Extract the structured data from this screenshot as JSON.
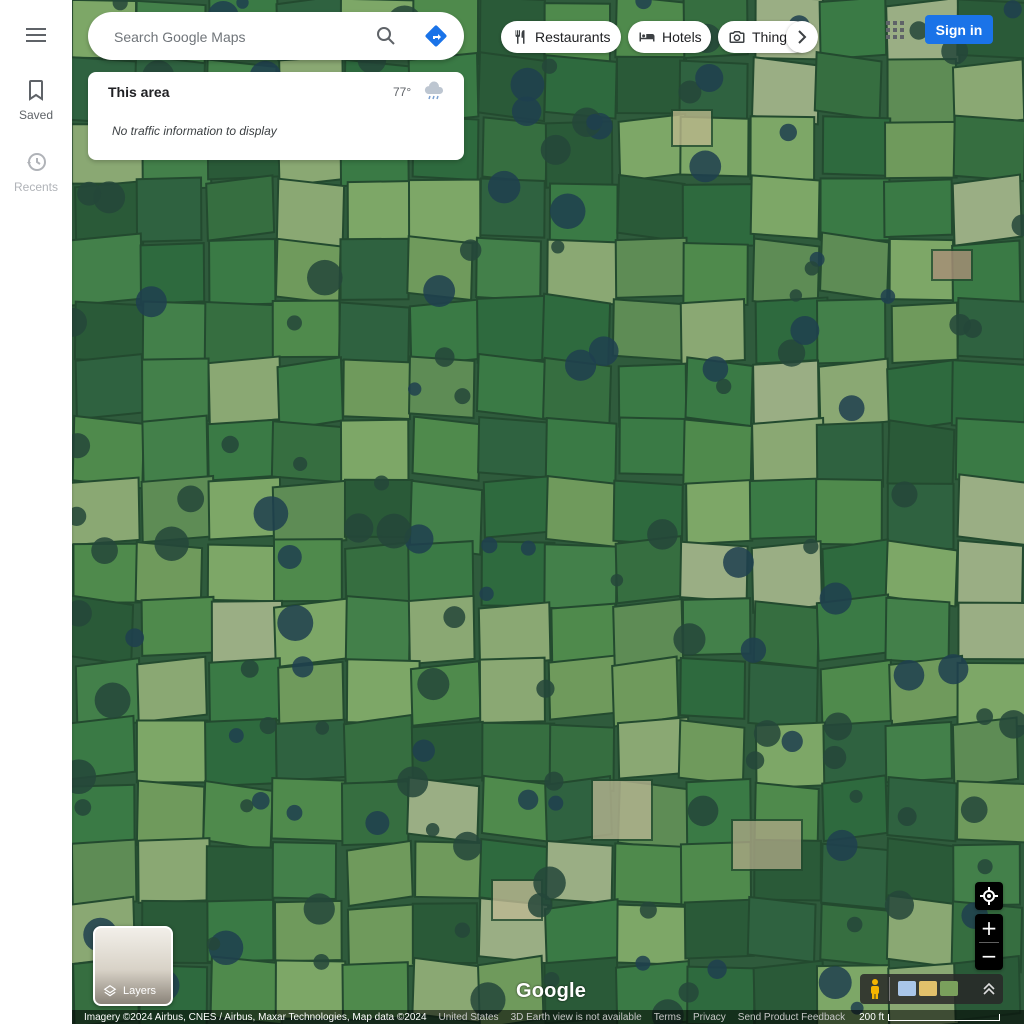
{
  "rail": {
    "saved_label": "Saved",
    "recents_label": "Recents"
  },
  "search": {
    "placeholder": "Search Google Maps"
  },
  "area_card": {
    "title": "This area",
    "temperature": "77°",
    "weather_icon": "rain-cloud-icon",
    "traffic_text": "No traffic information to display"
  },
  "chips": [
    {
      "label": "Restaurants",
      "icon": "fork-knife-icon"
    },
    {
      "label": "Hotels",
      "icon": "bed-icon"
    },
    {
      "label": "Things",
      "icon": "camera-icon"
    }
  ],
  "header": {
    "sign_in_label": "Sign in"
  },
  "layers": {
    "label": "Layers"
  },
  "branding": {
    "logo": "Google"
  },
  "zoom": {
    "plus": "+",
    "minus": "−"
  },
  "footer": {
    "attribution": "Imagery ©2024 Airbus, CNES / Airbus, Maxar Technologies, Map data ©2024",
    "region": "United States",
    "earth_notice": "3D Earth view is not available",
    "terms": "Terms",
    "privacy": "Privacy",
    "feedback": "Send Product Feedback",
    "scale_label": "200 ft"
  },
  "colors": {
    "accent": "#1a73e8",
    "field_dark": "#2f5b3c",
    "field_light": "#6f9a5c"
  }
}
